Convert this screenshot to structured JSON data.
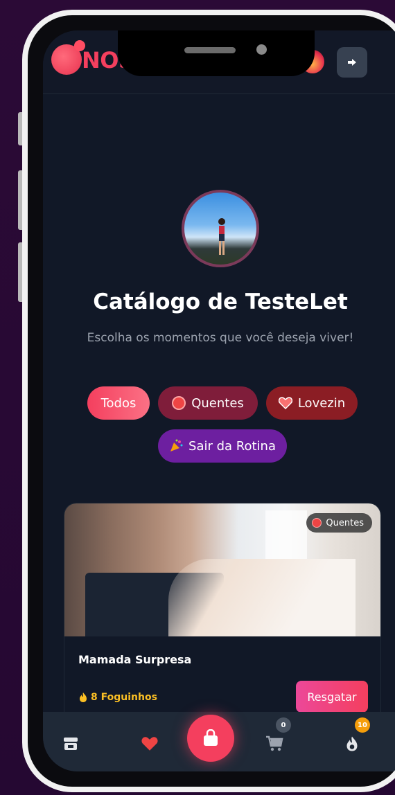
{
  "header": {
    "app_title": "NOSSO MOMENTO"
  },
  "profile": {
    "title": "Catálogo de TesteLet",
    "subtitle": "Escolha os momentos que você deseja viver!"
  },
  "filters": [
    {
      "label": "Todos",
      "active": true
    },
    {
      "label": "Quentes",
      "icon": "angry-face-icon"
    },
    {
      "label": "Lovezin",
      "icon": "heart-icon"
    },
    {
      "label": "Sair da Rotina",
      "icon": "party-popper-icon"
    }
  ],
  "card": {
    "tag": "Quentes",
    "title": "Mamada Surpresa",
    "price": "8 Foguinhos",
    "redeem_label": "Resgatar"
  },
  "nav": {
    "cart_badge": "0",
    "flame_badge": "10"
  },
  "colors": {
    "accent": "#f43f5e",
    "background": "#111827",
    "frame": "#2b0a36"
  }
}
